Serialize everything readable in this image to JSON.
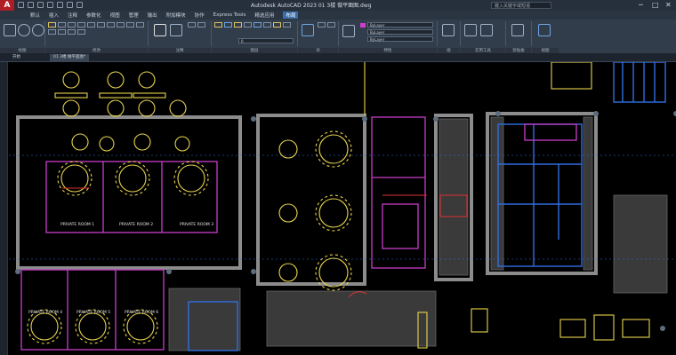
{
  "title_bar": {
    "window_title": "Autodesk AutoCAD 2023    01  3楼 做平面图.dwg",
    "search_placeholder": "键入关键字或短语",
    "window_controls": [
      "─",
      "□",
      "✕"
    ],
    "app_logo": "A"
  },
  "menu": [
    "默认",
    "插入",
    "注释",
    "参数化",
    "视图",
    "管理",
    "输出",
    "附加模块",
    "协作",
    "Express Tools",
    "精选应用",
    "布局"
  ],
  "active_menu_index": 11,
  "ribbon_panels": [
    "绘图",
    "修改",
    "注释",
    "图层",
    "块",
    "特性",
    "组",
    "实用工具",
    "剪贴板",
    "视图"
  ],
  "ribbon_fields": {
    "layer_dropdown": "0",
    "color_dropdown": "ByLayer",
    "linetype_dropdown": "ByLayer",
    "lineweight_dropdown": "ByLayer"
  },
  "document_tabs": [
    "开始",
    "01 3楼 做平面图*"
  ],
  "active_tab_index": 1,
  "drawing_labels": {
    "private_room_1": "PRIVATE ROOM 1",
    "private_room_2": "PRIVATE ROOM 2",
    "private_room_3": "PRIVATE ROOM 3",
    "private_room_4": "PRIVATE ROOM 4",
    "private_room_5": "PRIVATE ROOM 5",
    "private_room_6": "PRIVATE ROOM 6"
  },
  "colors": {
    "canvas": "#000000",
    "ribbon": "#323d4b",
    "titlebar": "#26303c",
    "accent": "#3a6ea8",
    "wall_grey": "#9a9a9a",
    "furniture_yellow": "#e8d44d",
    "partition_magenta": "#c83cc8",
    "window_blue": "#2f6ee0",
    "door_red": "#e03030"
  }
}
